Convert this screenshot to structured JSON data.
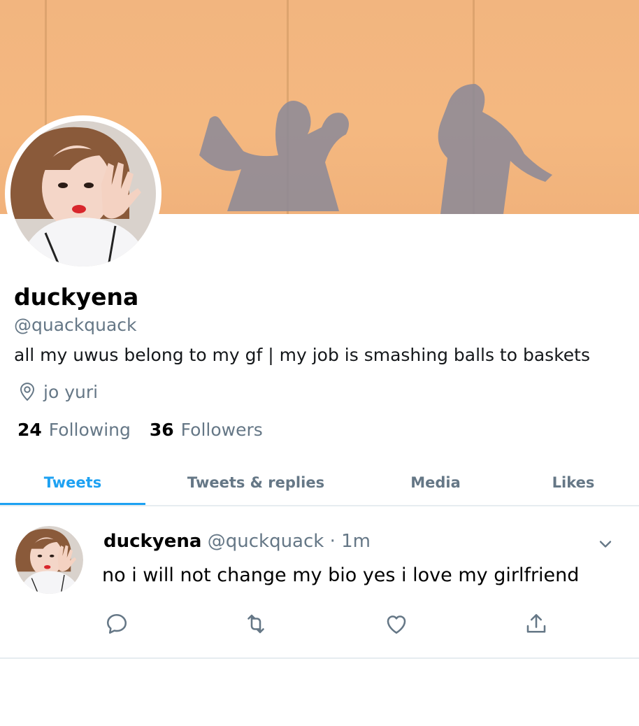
{
  "profile": {
    "display_name": "duckyena",
    "handle": "@quackquack",
    "bio": "all my uwus belong to my gf | my job is smashing balls to baskets",
    "location": "jo yuri",
    "following_count": "24",
    "following_label": "Following",
    "followers_count": "36",
    "followers_label": "Followers"
  },
  "tabs": [
    {
      "label": "Tweets",
      "active": true
    },
    {
      "label": "Tweets & replies",
      "active": false
    },
    {
      "label": "Media",
      "active": false
    },
    {
      "label": "Likes",
      "active": false
    }
  ],
  "tweet": {
    "author": "duckyena",
    "handle": "@quckquack",
    "separator": "·",
    "time": "1m",
    "text": "no i will not change my bio yes i love my girlfriend",
    "icons": [
      "reply-icon",
      "retweet-icon",
      "like-icon",
      "share-icon",
      "chevron-down-icon"
    ]
  },
  "colors": {
    "accent": "#1da1f2",
    "secondary_text": "#657786",
    "divider": "#e6ecf0",
    "banner": "#f2b57f"
  }
}
